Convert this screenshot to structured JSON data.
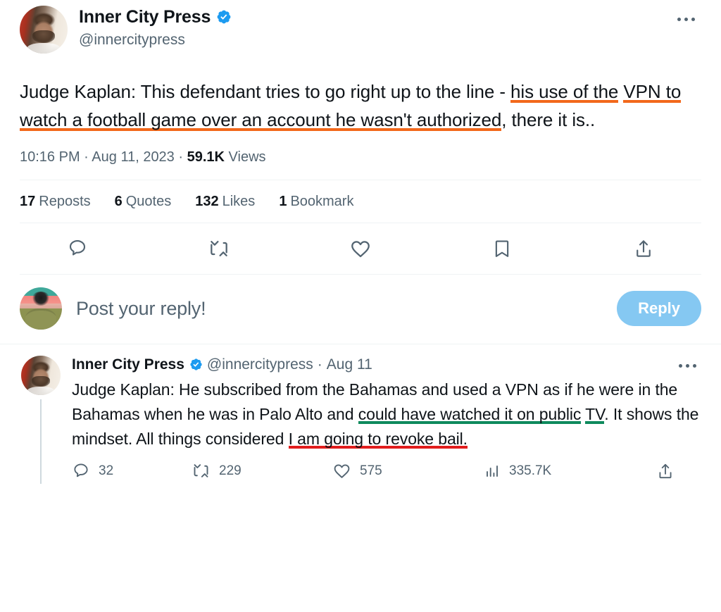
{
  "main_tweet": {
    "author": {
      "display_name": "Inner City Press",
      "handle": "@innercitypress",
      "verified_badge": "verified-badge-icon",
      "avatar": "inner-city-press-avatar"
    },
    "more_menu": "more-options-icon",
    "text": {
      "part1": "Judge Kaplan: This defendant tries to go right up to the line - ",
      "highlight_orange_1": "his use of the",
      "highlight_orange_2": "VPN to watch a football game over an account he wasn't authorized",
      "part2": ", there it is.."
    },
    "meta": {
      "time": "10:16 PM",
      "separator": "·",
      "date": "Aug 11, 2023",
      "views_count": "59.1K",
      "views_label": "Views"
    },
    "stats": [
      {
        "count": "17",
        "label": "Reposts"
      },
      {
        "count": "6",
        "label": "Quotes"
      },
      {
        "count": "132",
        "label": "Likes"
      },
      {
        "count": "1",
        "label": "Bookmark"
      }
    ],
    "actions": [
      {
        "name": "reply-icon"
      },
      {
        "name": "repost-icon"
      },
      {
        "name": "like-icon"
      },
      {
        "name": "bookmark-icon"
      },
      {
        "name": "share-icon"
      }
    ]
  },
  "composer": {
    "avatar": "current-user-avatar",
    "placeholder": "Post your reply!",
    "reply_button_label": "Reply",
    "reply_button_color": "#85c8f2"
  },
  "reply_tweet": {
    "author": {
      "display_name": "Inner City Press",
      "handle": "@innercitypress",
      "verified_badge": "verified-badge-icon",
      "avatar": "inner-city-press-avatar"
    },
    "separator": "·",
    "date": "Aug 11",
    "more_menu": "more-options-icon",
    "text": {
      "part1": "Judge Kaplan: He subscribed from the Bahamas and used a VPN as if he were in the Bahamas when he was in Palo Alto and ",
      "highlight_green_1": "could have watched it on public",
      "highlight_green_2": "TV",
      "part2": ". It shows the mindset. All things considered ",
      "highlight_red": "I am going to revoke bail.",
      "part3": ""
    },
    "actions": [
      {
        "icon": "reply-icon",
        "count": "32"
      },
      {
        "icon": "repost-icon",
        "count": "229"
      },
      {
        "icon": "like-icon",
        "count": "575"
      },
      {
        "icon": "views-icon",
        "count": "335.7K"
      },
      {
        "icon": "share-icon",
        "count": ""
      }
    ]
  },
  "colors": {
    "orange_highlight": "#f2681b",
    "green_highlight": "#0f8a5d",
    "red_highlight": "#e11d1d",
    "verified_blue": "#1d9bf0",
    "muted_text": "#536471"
  }
}
